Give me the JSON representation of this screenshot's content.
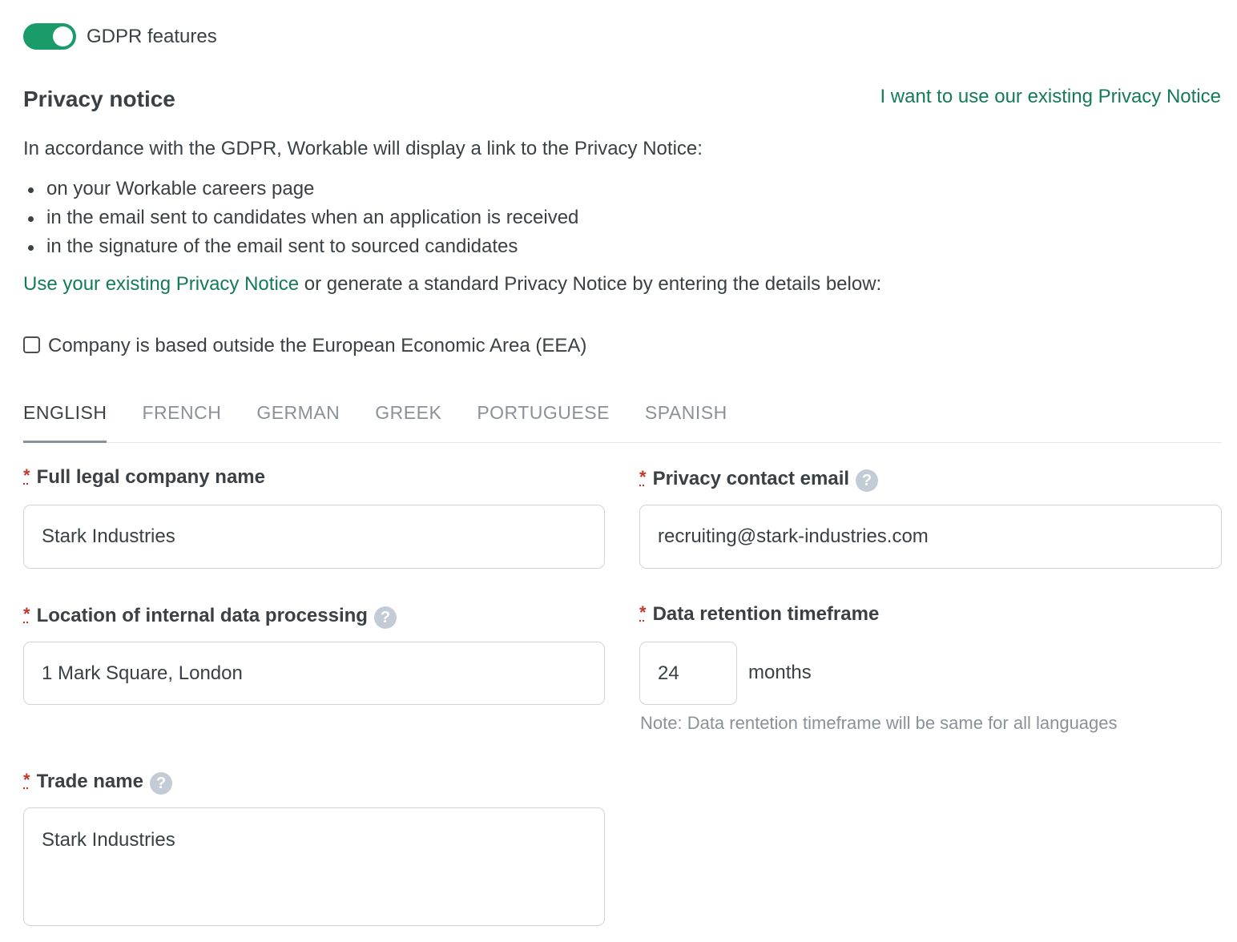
{
  "gdpr": {
    "toggle_label": "GDPR features",
    "enabled": true
  },
  "privacy": {
    "heading": "Privacy notice",
    "existing_link": "I want to use our existing Privacy Notice",
    "intro": "In accordance with the GDPR, Workable will display a link to the Privacy Notice:",
    "bullets": [
      "on your Workable careers page",
      "in the email sent to candidates when an application is received",
      "in the signature of the email sent to sourced candidates"
    ],
    "use_link": "Use your existing Privacy Notice",
    "use_rest": " or generate a standard Privacy Notice by entering the details below:",
    "eea_label": "Company is based outside the European Economic Area (EEA)"
  },
  "tabs": [
    {
      "label": "ENGLISH",
      "active": true
    },
    {
      "label": "FRENCH"
    },
    {
      "label": "GERMAN"
    },
    {
      "label": "GREEK"
    },
    {
      "label": "PORTUGUESE"
    },
    {
      "label": "SPANISH"
    }
  ],
  "form": {
    "required_mark": "*",
    "help_glyph": "?",
    "legal_name": {
      "label": "Full legal company name",
      "value": "Stark Industries"
    },
    "privacy_email": {
      "label": "Privacy contact email",
      "value": "recruiting@stark-industries.com"
    },
    "location": {
      "label": "Location of internal data processing",
      "value": "1 Mark Square, London"
    },
    "retention": {
      "label": "Data retention timeframe",
      "value": "24",
      "unit": "months",
      "note": "Note: Data rentetion timeframe will be same for all languages"
    },
    "trade_name": {
      "label": "Trade name",
      "value": "Stark Industries"
    }
  },
  "colors": {
    "accent": "#1a9c6a",
    "link": "#137a5a",
    "required": "#c0392b"
  }
}
